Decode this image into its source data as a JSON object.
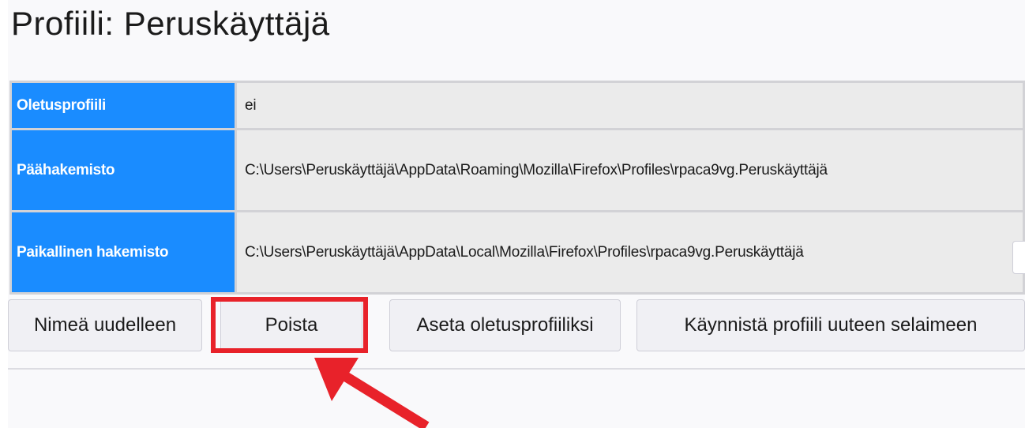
{
  "page": {
    "title": "Profiili: Peruskäyttäjä"
  },
  "profile_table": {
    "rows": [
      {
        "label": "Oletusprofiili",
        "value": "ei"
      },
      {
        "label": "Päähakemisto",
        "value": "C:\\Users\\Peruskäyttäjä\\AppData\\Roaming\\Mozilla\\Firefox\\Profiles\\rpaca9vg.Peruskäyttäjä"
      },
      {
        "label": "Paikallinen hakemisto",
        "value": "C:\\Users\\Peruskäyttäjä\\AppData\\Local\\Mozilla\\Firefox\\Profiles\\rpaca9vg.Peruskäyttäjä"
      }
    ]
  },
  "actions": {
    "rename": "Nimeä uudelleen",
    "delete": "Poista",
    "set_default": "Aseta oletusprofiiliksi",
    "launch": "Käynnistä profiili uuteen selaimeen"
  },
  "annotation": {
    "highlight_color": "#e8222a",
    "highlighted_action": "delete",
    "icon": "arrow-up-left-icon"
  },
  "colors": {
    "header_cell_bg": "#1a8cff",
    "value_cell_bg": "#ebebeb"
  }
}
